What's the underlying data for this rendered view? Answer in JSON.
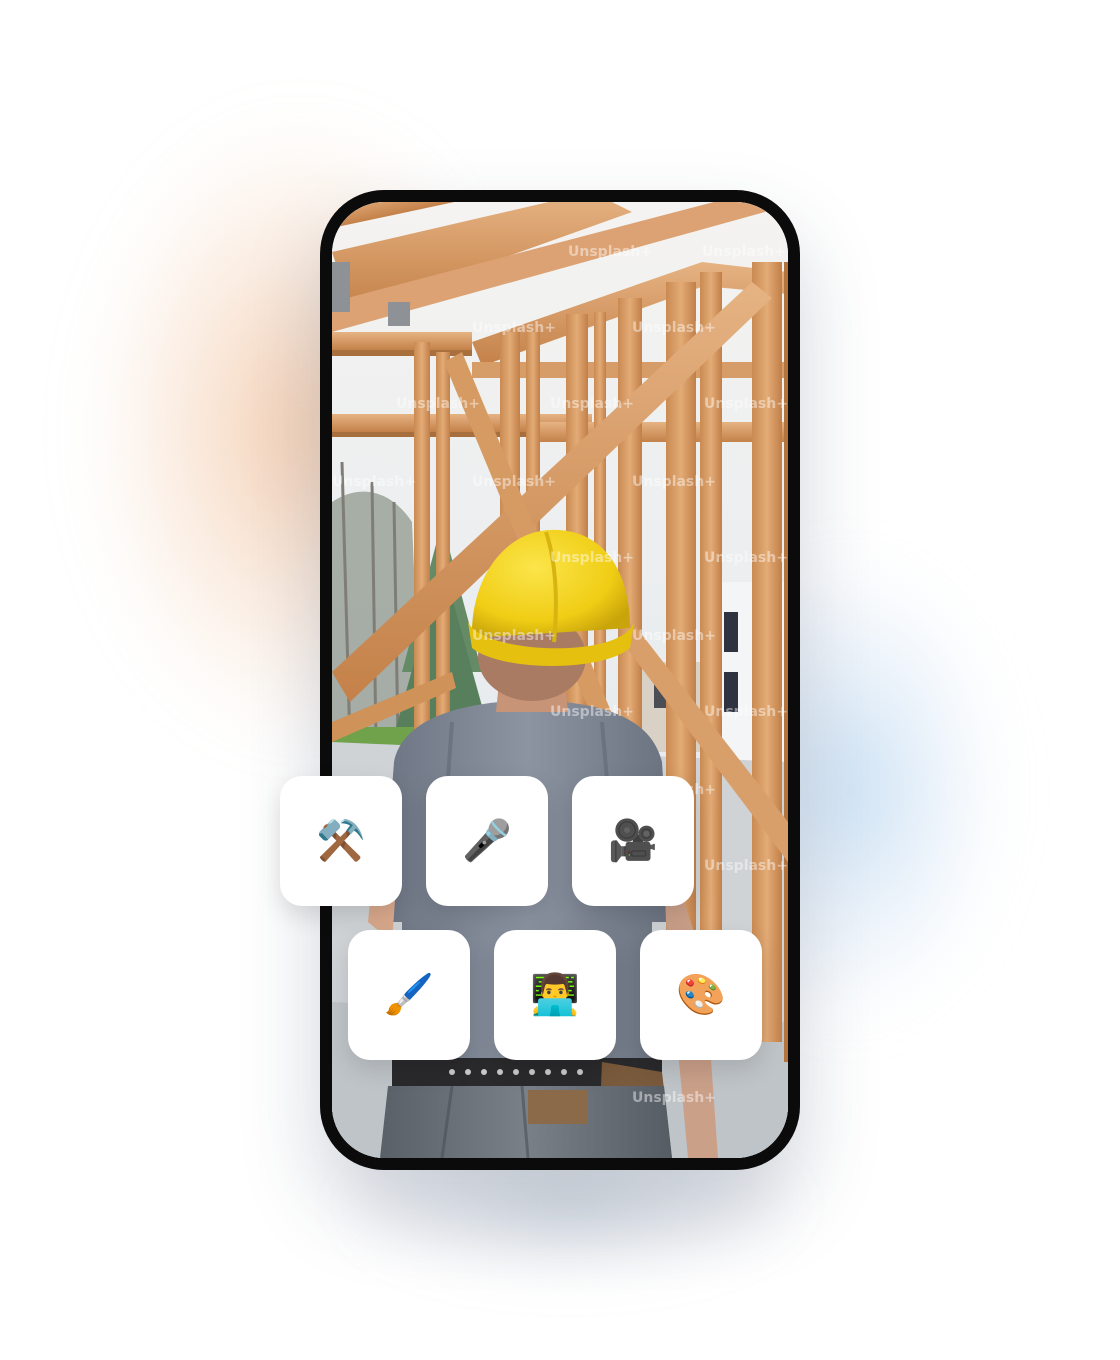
{
  "watermark": "Unsplash+",
  "apps": [
    {
      "id": "tools",
      "icon": "hammer-and-wrench-icon",
      "glyph": "⚒️"
    },
    {
      "id": "microphone",
      "icon": "microphone-icon",
      "glyph": "🎤"
    },
    {
      "id": "movie-camera",
      "icon": "movie-camera-icon",
      "glyph": "🎥"
    },
    {
      "id": "paintbrush",
      "icon": "paintbrush-icon",
      "glyph": "🖌️"
    },
    {
      "id": "technologist",
      "icon": "technologist-icon",
      "glyph": "👨‍💻"
    },
    {
      "id": "palette",
      "icon": "artist-palette-icon",
      "glyph": "🎨"
    }
  ],
  "colors": {
    "phone_frame": "#0b0b0b",
    "tile_background": "#ffffff",
    "hard_hat": "#f2d21b",
    "lumber": "#d9a06b"
  }
}
